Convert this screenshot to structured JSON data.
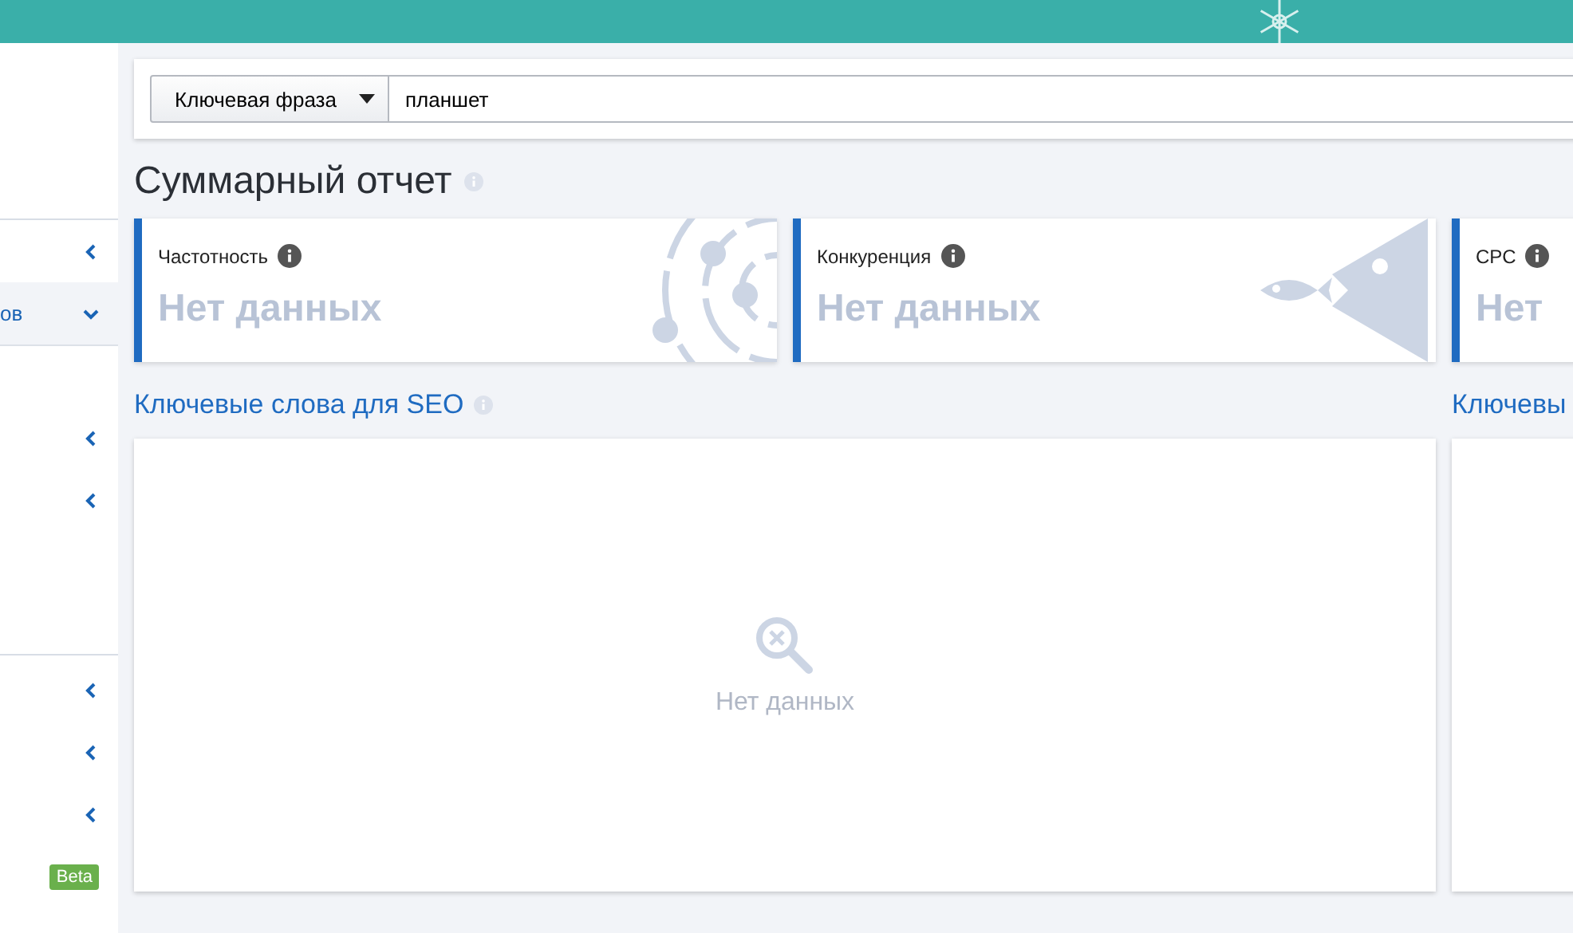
{
  "sidebar": {
    "items": [
      {
        "kind": "group",
        "expanded": false
      },
      {
        "kind": "group",
        "label": "ов",
        "expanded": true
      },
      {
        "kind": "group",
        "expanded": false
      },
      {
        "kind": "group",
        "expanded": false
      },
      {
        "kind": "divider"
      },
      {
        "kind": "group",
        "expanded": false
      },
      {
        "kind": "group",
        "expanded": false
      },
      {
        "kind": "group",
        "expanded": false
      },
      {
        "kind": "badge",
        "badge": "Beta"
      }
    ]
  },
  "search": {
    "mode": "Ключевая фраза",
    "value": "планшет"
  },
  "title": "Суммарный отчет",
  "metrics": [
    {
      "kind": "planets",
      "label": "Частотность",
      "value": "Нет данных"
    },
    {
      "kind": "fish",
      "label": "Конкуренция",
      "value": "Нет данных"
    },
    {
      "kind": "plain",
      "label": "CPC",
      "value": "Нет"
    }
  ],
  "sections": [
    {
      "title": "Ключевые слова для SEO",
      "info": true,
      "empty_text": "Нет данных"
    },
    {
      "title": "Ключевы"
    }
  ]
}
